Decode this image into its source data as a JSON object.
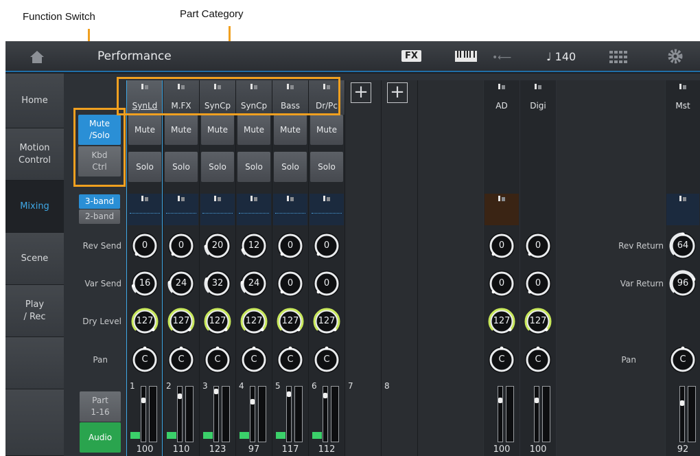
{
  "annotations": {
    "function_switch": "Function Switch",
    "part_category": "Part Category"
  },
  "topbar": {
    "title": "Performance",
    "fx_label": "FX",
    "tempo": "♩ 140",
    "icons": [
      "home-icon",
      "keyboard-icon",
      "usb-icon",
      "grid-icon",
      "gear-icon"
    ]
  },
  "nav": {
    "items": [
      {
        "label": "Home"
      },
      {
        "label": "Motion\nControl"
      },
      {
        "label": "Mixing",
        "active": true
      },
      {
        "label": "Scene"
      },
      {
        "label": "Play\n/ Rec"
      }
    ]
  },
  "function_switch": {
    "mute_solo": "Mute\n/Solo",
    "kbd_ctrl": "Kbd\nCtrl"
  },
  "eq_switch": {
    "band3": "3-band",
    "band2": "2-band"
  },
  "parts_switch": {
    "part": "Part\n1-16",
    "audio": "Audio"
  },
  "row_labels": {
    "rev_send": "Rev Send",
    "var_send": "Var Send",
    "dry_level": "Dry Level",
    "pan": "Pan"
  },
  "master_labels": {
    "rev_return": "Rev Return",
    "var_return": "Var Return",
    "pan": "Pan"
  },
  "buttons": {
    "mute": "Mute",
    "solo": "Solo"
  },
  "parts": [
    {
      "num": "1",
      "category": "SynLd",
      "rev": "0",
      "var": "16",
      "dry": "127",
      "pan": "C",
      "vol": "100",
      "selected": true
    },
    {
      "num": "2",
      "category": "M.FX",
      "rev": "0",
      "var": "24",
      "dry": "127",
      "pan": "C",
      "vol": "110"
    },
    {
      "num": "3",
      "category": "SynCp",
      "rev": "20",
      "var": "32",
      "dry": "127",
      "pan": "C",
      "vol": "123"
    },
    {
      "num": "4",
      "category": "SynCp",
      "rev": "12",
      "var": "24",
      "dry": "127",
      "pan": "C",
      "vol": "97"
    },
    {
      "num": "5",
      "category": "Bass",
      "rev": "0",
      "var": "0",
      "dry": "127",
      "pan": "C",
      "vol": "117"
    },
    {
      "num": "6",
      "category": "Dr/Pc",
      "rev": "0",
      "var": "0",
      "dry": "127",
      "pan": "C",
      "vol": "112"
    }
  ],
  "empty_parts": [
    {
      "num": "7"
    },
    {
      "num": "8"
    }
  ],
  "audio_parts": [
    {
      "label": "AD",
      "rev": "0",
      "var": "0",
      "dry": "127",
      "pan": "C",
      "vol": "100"
    },
    {
      "label": "Digi",
      "rev": "0",
      "var": "0",
      "dry": "127",
      "pan": "C",
      "vol": "100"
    }
  ],
  "master": {
    "label": "Mst",
    "rev_return": "64",
    "var_return": "96",
    "pan": "C",
    "vol": "92"
  },
  "colors": {
    "accent": "#2a8fd6",
    "callout": "#f0a020",
    "green": "#2aa44e",
    "knob_yellow": "#c8e85a"
  }
}
